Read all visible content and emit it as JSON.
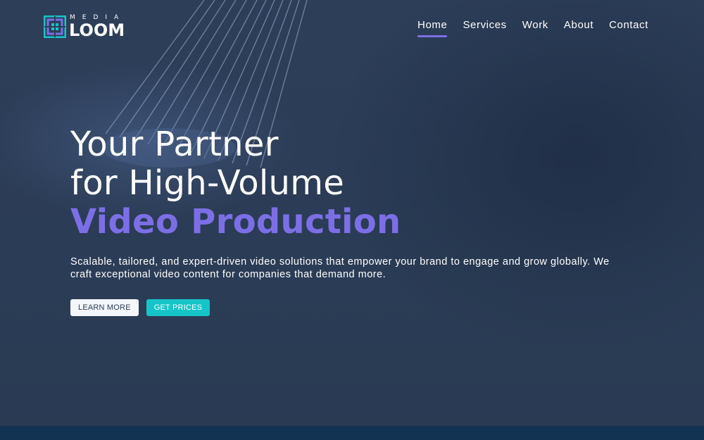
{
  "brand": {
    "top_text": "MEDIA",
    "main_text": "LOOM",
    "colors": {
      "teal": "#15c4c9",
      "purple": "#7c6fe6"
    },
    "icon": "woven-square-icon"
  },
  "nav": {
    "items": [
      {
        "label": "Home",
        "active": true
      },
      {
        "label": "Services",
        "active": false
      },
      {
        "label": "Work",
        "active": false
      },
      {
        "label": "About",
        "active": false
      },
      {
        "label": "Contact",
        "active": false
      }
    ]
  },
  "hero": {
    "line1": "Your Partner",
    "line2": "for High-Volume",
    "accent": "Video Production",
    "description": "Scalable, tailored, and expert-driven video solutions that empower your brand to engage and grow globally. We craft exceptional video content for companies that demand more.",
    "buttons": {
      "learn_more": "LEARN MORE",
      "get_prices": "GET PRICES"
    }
  },
  "theme": {
    "background": "#2c3d57",
    "accent": "#7c6fe6",
    "teal": "#15c4c9",
    "footer_band": "#133352"
  }
}
